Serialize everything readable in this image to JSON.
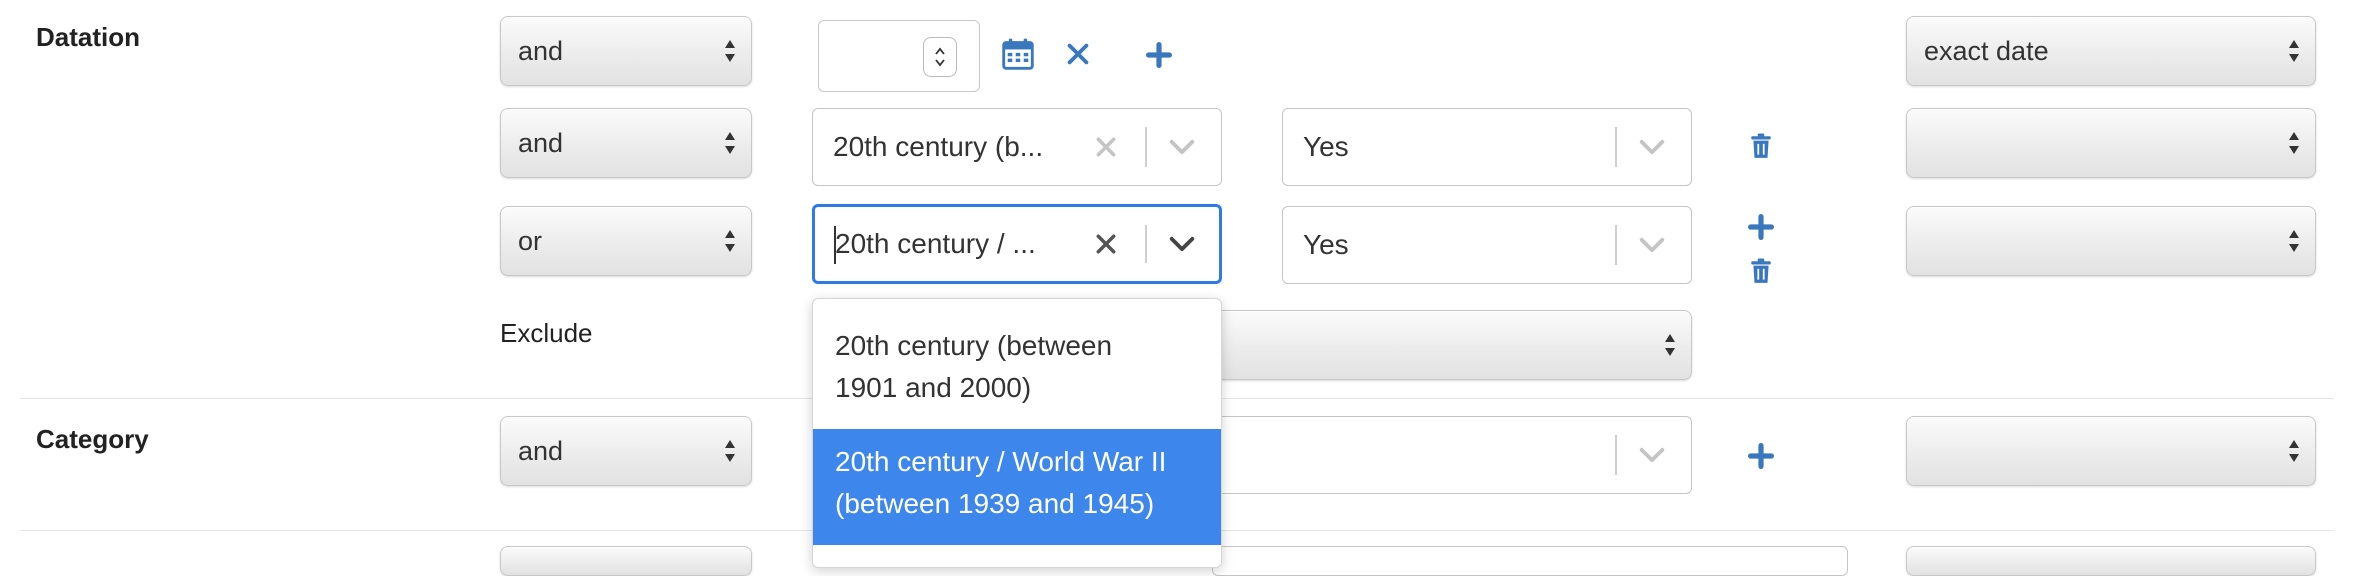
{
  "datation": {
    "label": "Datation",
    "rows": [
      {
        "operator": "and",
        "date_mode": "exact date"
      },
      {
        "operator": "and",
        "value": "20th century (b...",
        "bool": "Yes"
      },
      {
        "operator": "or",
        "value": "20th century / ...",
        "bool": "Yes"
      }
    ],
    "exclude_label": "Exclude"
  },
  "category": {
    "label": "Category",
    "operator": "and"
  },
  "dropdown": {
    "options": [
      {
        "line1": "20th century (between",
        "line2": "1901 and 2000)",
        "selected": false
      },
      {
        "line1": "20th century / World War II",
        "line2": "(between 1939 and 1945)",
        "selected": true
      }
    ]
  },
  "icons": {
    "calendar": "calendar-icon",
    "remove": "close-icon",
    "add": "plus-icon",
    "delete": "trash-icon",
    "clear": "clear-icon",
    "dropdown": "chevron-down-icon"
  },
  "colors": {
    "accent": "#2f7be6",
    "icon_blue": "#3a78bd",
    "selected_option": "#3d86eb"
  }
}
